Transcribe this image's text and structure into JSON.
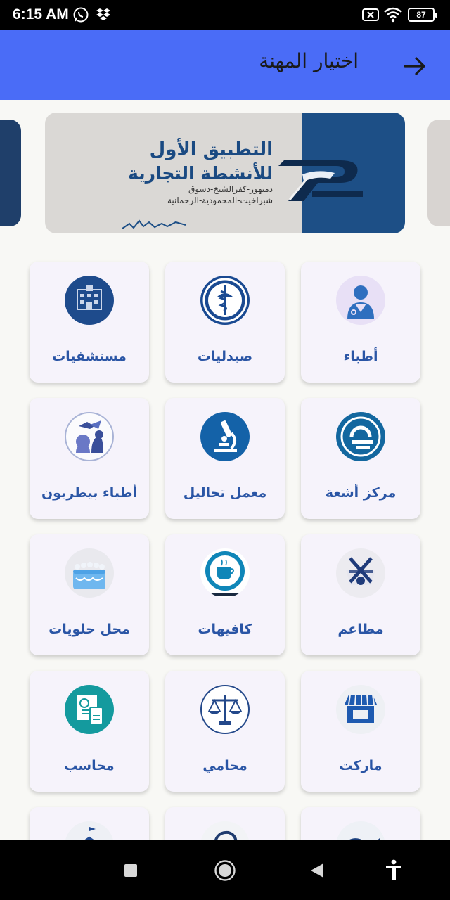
{
  "status_bar": {
    "time": "6:15 AM",
    "battery": "87",
    "icons": [
      "whatsapp-icon",
      "dropbox-icon",
      "no-sim-icon",
      "wifi-icon",
      "battery-icon"
    ]
  },
  "app_bar": {
    "title": "اختيار المهنة",
    "back_icon": "arrow-right-icon",
    "color": "#4a6cf7"
  },
  "banner": {
    "line1": "التطبيق الأول",
    "line2": "للأنشطة التجارية",
    "line3": "دمنهور-كفرالشيخ-دسوق",
    "line4": "شبراخيت-المحمودية-الرحمانية"
  },
  "categories": [
    {
      "label": "أطباء",
      "icon": "doctor-icon"
    },
    {
      "label": "صيدليات",
      "icon": "pharmacy-icon"
    },
    {
      "label": "مستشفيات",
      "icon": "hospital-icon"
    },
    {
      "label": "مركز أشعة",
      "icon": "radiology-icon"
    },
    {
      "label": "معمل تحاليل",
      "icon": "microscope-icon"
    },
    {
      "label": "أطباء بيطريون",
      "icon": "veterinary-icon"
    },
    {
      "label": "مطاعم",
      "icon": "restaurant-icon"
    },
    {
      "label": "كافيهات",
      "icon": "cafe-icon"
    },
    {
      "label": "محل حلويات",
      "icon": "cake-icon"
    },
    {
      "label": "ماركت",
      "icon": "market-icon"
    },
    {
      "label": "محامي",
      "icon": "lawyer-icon"
    },
    {
      "label": "محاسب",
      "icon": "accountant-icon"
    }
  ],
  "accent": "#2a55a5",
  "nav_bar": {
    "icons": [
      "recents-icon",
      "home-icon",
      "back-icon",
      "accessibility-icon"
    ]
  }
}
